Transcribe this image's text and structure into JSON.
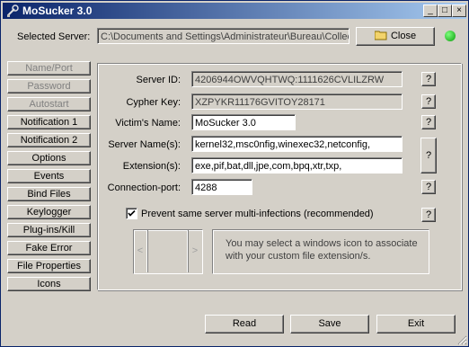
{
  "window": {
    "title": "MoSucker 3.0",
    "controls": [
      "_",
      "□",
      "×"
    ]
  },
  "server": {
    "label": "Selected Server:",
    "path": "C:\\Documents and Settings\\Administrateur\\Bureau\\Collect",
    "close_label": "Close",
    "status_color": "#0a9c0a"
  },
  "sidebar": [
    {
      "label": "Name/Port",
      "enabled": false
    },
    {
      "label": "Password",
      "enabled": false
    },
    {
      "label": "Autostart",
      "enabled": false
    },
    {
      "label": "Notification 1",
      "enabled": true
    },
    {
      "label": "Notification 2",
      "enabled": true
    },
    {
      "label": "Options",
      "enabled": true
    },
    {
      "label": "Events",
      "enabled": true
    },
    {
      "label": "Bind Files",
      "enabled": true
    },
    {
      "label": "Keylogger",
      "enabled": true
    },
    {
      "label": "Plug-ins/Kill",
      "enabled": true
    },
    {
      "label": "Fake Error",
      "enabled": true
    },
    {
      "label": "File Properties",
      "enabled": true
    },
    {
      "label": "Icons",
      "enabled": true
    }
  ],
  "form": {
    "server_id_label": "Server ID:",
    "server_id": "4206944OWVQHTWQ:1111626CVLILZRW",
    "cypher_key_label": "Cypher Key:",
    "cypher_key": "XZPYKR11176GVITOY28171",
    "victim_name_label": "Victim's Name:",
    "victim_name": "MoSucker 3.0",
    "server_names_label": "Server Name(s):",
    "server_names": "kernel32,msc0nfig,winexec32,netconfig,",
    "extensions_label": "Extension(s):",
    "extensions": "exe,pif,bat,dll,jpe,com,bpq,xtr,txp,",
    "port_label": "Connection-port:",
    "port": "4288",
    "prevent_label": "Prevent same server multi-infections (recommended)",
    "prevent_checked": true,
    "help": "?"
  },
  "icon_panel": {
    "prev": "<",
    "next": ">",
    "info": "You may select a windows icon to associate with your custom file extension/s."
  },
  "footer": {
    "read": "Read",
    "save": "Save",
    "exit": "Exit"
  }
}
